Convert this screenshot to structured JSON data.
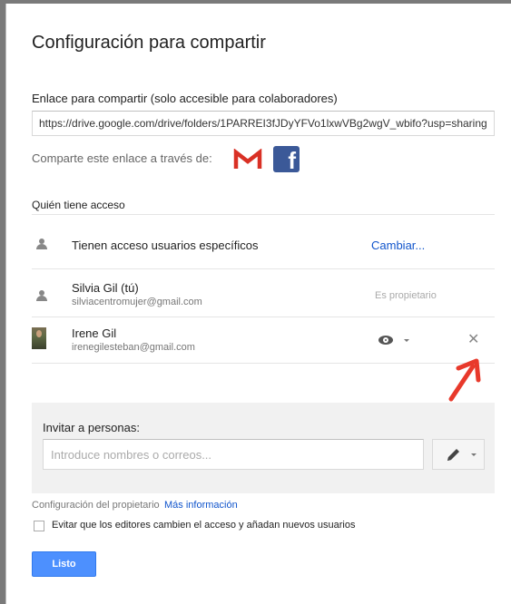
{
  "dialog": {
    "title": "Configuración para compartir",
    "link_label": "Enlace para compartir (solo accesible para colaboradores)",
    "link_value": "https://drive.google.com/drive/folders/1PARREI3fJDyYFVo1lxwVBg2wgV_wbifo?usp=sharing",
    "share_via_label": "Comparte este enlace a través de:",
    "share_icons": [
      "gmail-icon",
      "facebook-icon"
    ],
    "facebook_glyph": "f"
  },
  "access": {
    "section_label": "Quién tiene acceso",
    "type_icon": "people-icon",
    "type_label": "Tienen acceso usuarios específicos",
    "change_label": "Cambiar..."
  },
  "people": [
    {
      "name": "Silvia Gil (tú)",
      "email": "silviacentromujer@gmail.com",
      "role": "Es propietario",
      "icon": "person-icon"
    },
    {
      "name": "Irene Gil",
      "email": "irenegilesteban@gmail.com",
      "icon": "avatar",
      "permission_icon": "eye-icon",
      "remove_symbol": "✕"
    }
  ],
  "invite": {
    "label": "Invitar a personas:",
    "placeholder": "Introduce nombres o correos...",
    "permission_icon": "pencil-icon"
  },
  "footer": {
    "owner_settings": "Configuración del propietario",
    "more_info": "Más información",
    "checkbox_label": "Evitar que los editores cambien el acceso y añadan nuevos usuarios",
    "checkbox_checked": false,
    "done_label": "Listo"
  },
  "colors": {
    "link": "#1155cc",
    "primary_button": "#4d90fe",
    "facebook": "#3b5998",
    "gmail": "#d93025",
    "annotation_arrow": "#e8392b"
  }
}
